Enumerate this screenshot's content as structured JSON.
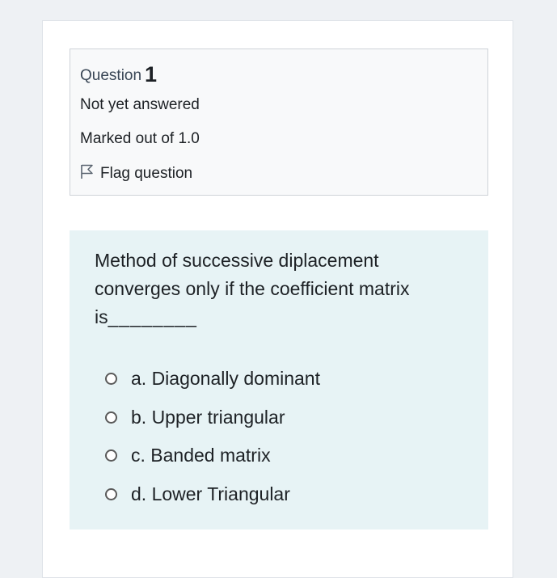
{
  "question_info": {
    "label": "Question",
    "number": "1",
    "state": "Not yet answered",
    "grade": "Marked out of 1.0",
    "flag_label": "Flag question",
    "flag_icon": "flag-outline-icon"
  },
  "question": {
    "text": "Method of successive diplacement converges only if the coefficient matrix is",
    "blank": "________",
    "answers": [
      {
        "label": "a. Diagonally dominant",
        "selected": false
      },
      {
        "label": "b. Upper triangular",
        "selected": false
      },
      {
        "label": "c. Banded matrix",
        "selected": false
      },
      {
        "label": "d. Lower Triangular",
        "selected": false
      }
    ]
  },
  "colors": {
    "page_background": "#eef1f4",
    "info_background": "#f8f9fa",
    "question_background": "#e7f3f5",
    "text": "#1d2125"
  }
}
